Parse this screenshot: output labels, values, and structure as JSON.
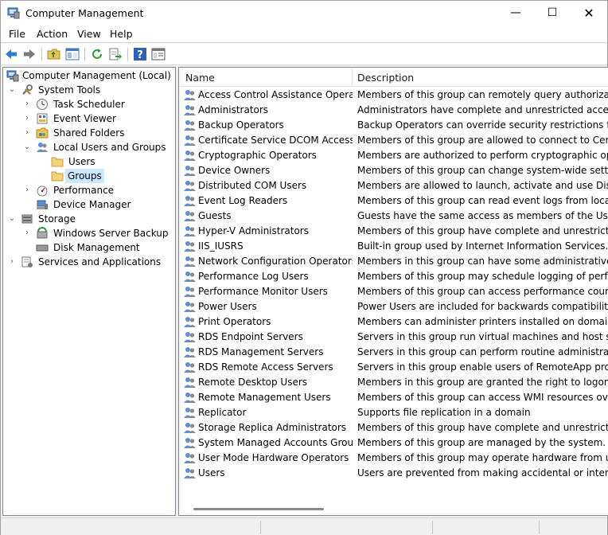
{
  "window": {
    "title": "Computer Management",
    "controls": {
      "minimize": "—",
      "maximize": "☐",
      "close": "✕"
    }
  },
  "menu": [
    "File",
    "Action",
    "View",
    "Help"
  ],
  "toolbar": [
    "back-icon",
    "forward-icon",
    "up-folder-icon",
    "show-hide-tree-icon",
    "refresh-icon",
    "export-list-icon",
    "help-icon",
    "properties-icon"
  ],
  "tree": [
    {
      "label": "Computer Management (Local)",
      "icon": "computer-management-icon",
      "expanded": true
    },
    {
      "label": "System Tools",
      "icon": "tools-icon",
      "expanded": true
    },
    {
      "label": "Task Scheduler",
      "icon": "clock-icon",
      "expanded": false
    },
    {
      "label": "Event Viewer",
      "icon": "event-viewer-icon",
      "expanded": false
    },
    {
      "label": "Shared Folders",
      "icon": "shared-folder-icon",
      "expanded": false
    },
    {
      "label": "Local Users and Groups",
      "icon": "users-icon",
      "expanded": true
    },
    {
      "label": "Users",
      "icon": "folder-icon"
    },
    {
      "label": "Groups",
      "icon": "folder-icon",
      "selected": true
    },
    {
      "label": "Performance",
      "icon": "performance-icon",
      "expanded": false
    },
    {
      "label": "Device Manager",
      "icon": "device-manager-icon"
    },
    {
      "label": "Storage",
      "icon": "storage-icon",
      "expanded": true
    },
    {
      "label": "Windows Server Backup",
      "icon": "backup-icon",
      "expanded": false
    },
    {
      "label": "Disk Management",
      "icon": "disk-icon"
    },
    {
      "label": "Services and Applications",
      "icon": "services-icon",
      "expanded": false
    }
  ],
  "list": {
    "columns": {
      "name": "Name",
      "description": "Description"
    },
    "rows": [
      {
        "name": "Access Control Assistance Operators",
        "description": "Members of this group can remotely query authorization attributes"
      },
      {
        "name": "Administrators",
        "description": "Administrators have complete and unrestricted access to the computer"
      },
      {
        "name": "Backup Operators",
        "description": "Backup Operators can override security restrictions for the sole purpose"
      },
      {
        "name": "Certificate Service DCOM Access",
        "description": "Members of this group are allowed to connect to Certification Authorities"
      },
      {
        "name": "Cryptographic Operators",
        "description": "Members are authorized to perform cryptographic operations."
      },
      {
        "name": "Device Owners",
        "description": "Members of this group can change system-wide settings."
      },
      {
        "name": "Distributed COM Users",
        "description": "Members are allowed to launch, activate and use Distributed COM objects"
      },
      {
        "name": "Event Log Readers",
        "description": "Members of this group can read event logs from local machine"
      },
      {
        "name": "Guests",
        "description": "Guests have the same access as members of the Users group by default"
      },
      {
        "name": "Hyper-V Administrators",
        "description": "Members of this group have complete and unrestricted access to all features"
      },
      {
        "name": "IIS_IUSRS",
        "description": "Built-in group used by Internet Information Services."
      },
      {
        "name": "Network Configuration Operators",
        "description": "Members in this group can have some administrative privileges"
      },
      {
        "name": "Performance Log Users",
        "description": "Members of this group may schedule logging of performance counters"
      },
      {
        "name": "Performance Monitor Users",
        "description": "Members of this group can access performance counter data locally"
      },
      {
        "name": "Power Users",
        "description": "Power Users are included for backwards compatibility and possess"
      },
      {
        "name": "Print Operators",
        "description": "Members can administer printers installed on domain controllers"
      },
      {
        "name": "RDS Endpoint Servers",
        "description": "Servers in this group run virtual machines and host sessions"
      },
      {
        "name": "RDS Management Servers",
        "description": "Servers in this group can perform routine administrative actions"
      },
      {
        "name": "RDS Remote Access Servers",
        "description": "Servers in this group enable users of RemoteApp programs and"
      },
      {
        "name": "Remote Desktop Users",
        "description": "Members in this group are granted the right to logon remotely"
      },
      {
        "name": "Remote Management Users",
        "description": "Members of this group can access WMI resources over management"
      },
      {
        "name": "Replicator",
        "description": "Supports file replication in a domain"
      },
      {
        "name": "Storage Replica Administrators",
        "description": "Members of this group have complete and unrestricted access to all"
      },
      {
        "name": "System Managed Accounts Group",
        "description": "Members of this group are managed by the system."
      },
      {
        "name": "User Mode Hardware Operators",
        "description": "Members of this group may operate hardware from user mode."
      },
      {
        "name": "Users",
        "description": "Users are prevented from making accidental or intentional system-wide"
      }
    ]
  },
  "colors": {
    "selection": "#cce8ff",
    "accent": "#0078d7"
  }
}
